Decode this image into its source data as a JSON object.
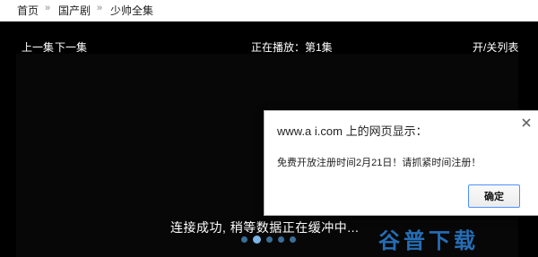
{
  "breadcrumb": {
    "items": [
      "首页",
      "国产剧",
      "少帅全集"
    ],
    "separator": "»"
  },
  "player": {
    "prev_label": "上一集",
    "next_label": "下一集",
    "now_playing": "正在播放：第1集",
    "playlist_toggle": "开/关列表",
    "status": "连接成功, 稍等数据正在缓冲中...",
    "loading_dots": 5,
    "active_dot": 1
  },
  "dialog": {
    "title": "www.a i.com 上的网页显示：",
    "message": "免费开放注册时间2月21日！请抓紧时间注册！",
    "ok_label": "确定"
  },
  "watermark": {
    "text": "谷普下载"
  },
  "colors": {
    "player_bg": "#000000",
    "dialog_button_border": "#4d90fe",
    "dot_active": "#7bb5e8",
    "dot": "#3a6f9a",
    "watermark": "#2a7fd4"
  }
}
